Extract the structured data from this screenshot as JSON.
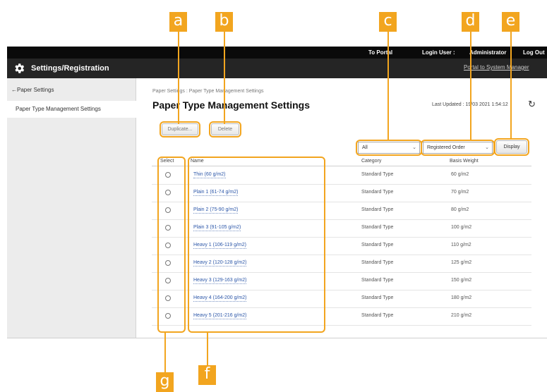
{
  "callouts": [
    "a",
    "b",
    "c",
    "d",
    "e",
    "f",
    "g"
  ],
  "header": {
    "to_portal": "To Portal",
    "login_user_label": "Login User :",
    "login_user": "Administrator",
    "logout": "Log Out",
    "app_title": "Settings/Registration",
    "portal_link": "Portal to System Manager"
  },
  "sidebar": {
    "back_item": "Paper Settings",
    "active_item": "Paper Type Management Settings"
  },
  "main": {
    "breadcrumb": "Paper Settings : Paper Type Management Settings",
    "title": "Paper Type Management Settings",
    "last_updated": "Last Updated : 19/03 2021 1:54:12",
    "duplicate_label": "Duplicate...",
    "delete_label": "Delete",
    "category_filter": "All",
    "order_filter": "Registered Order",
    "display_label": "Display"
  },
  "table": {
    "headers": {
      "select": "Select",
      "name": "Name",
      "category": "Category",
      "basis_weight": "Basis Weight"
    },
    "rows": [
      {
        "name": "Thin (60 g/m2)",
        "category": "Standard Type",
        "weight": "60 g/m2"
      },
      {
        "name": "Plain 1 (61-74 g/m2)",
        "category": "Standard Type",
        "weight": "70 g/m2"
      },
      {
        "name": "Plain 2 (75-90 g/m2)",
        "category": "Standard Type",
        "weight": "80 g/m2"
      },
      {
        "name": "Plain 3 (91-105 g/m2)",
        "category": "Standard Type",
        "weight": "100 g/m2"
      },
      {
        "name": "Heavy 1 (106-119 g/m2)",
        "category": "Standard Type",
        "weight": "110 g/m2"
      },
      {
        "name": "Heavy 2 (120-128 g/m2)",
        "category": "Standard Type",
        "weight": "125 g/m2"
      },
      {
        "name": "Heavy 3 (129-163 g/m2)",
        "category": "Standard Type",
        "weight": "150 g/m2"
      },
      {
        "name": "Heavy 4 (164-200 g/m2)",
        "category": "Standard Type",
        "weight": "180 g/m2"
      },
      {
        "name": "Heavy 5 (201-216 g/m2)",
        "category": "Standard Type",
        "weight": "210 g/m2"
      }
    ]
  },
  "colors": {
    "callout": "#f2a51f",
    "topbar": "#0a0a0a",
    "link": "#2b56a8"
  }
}
